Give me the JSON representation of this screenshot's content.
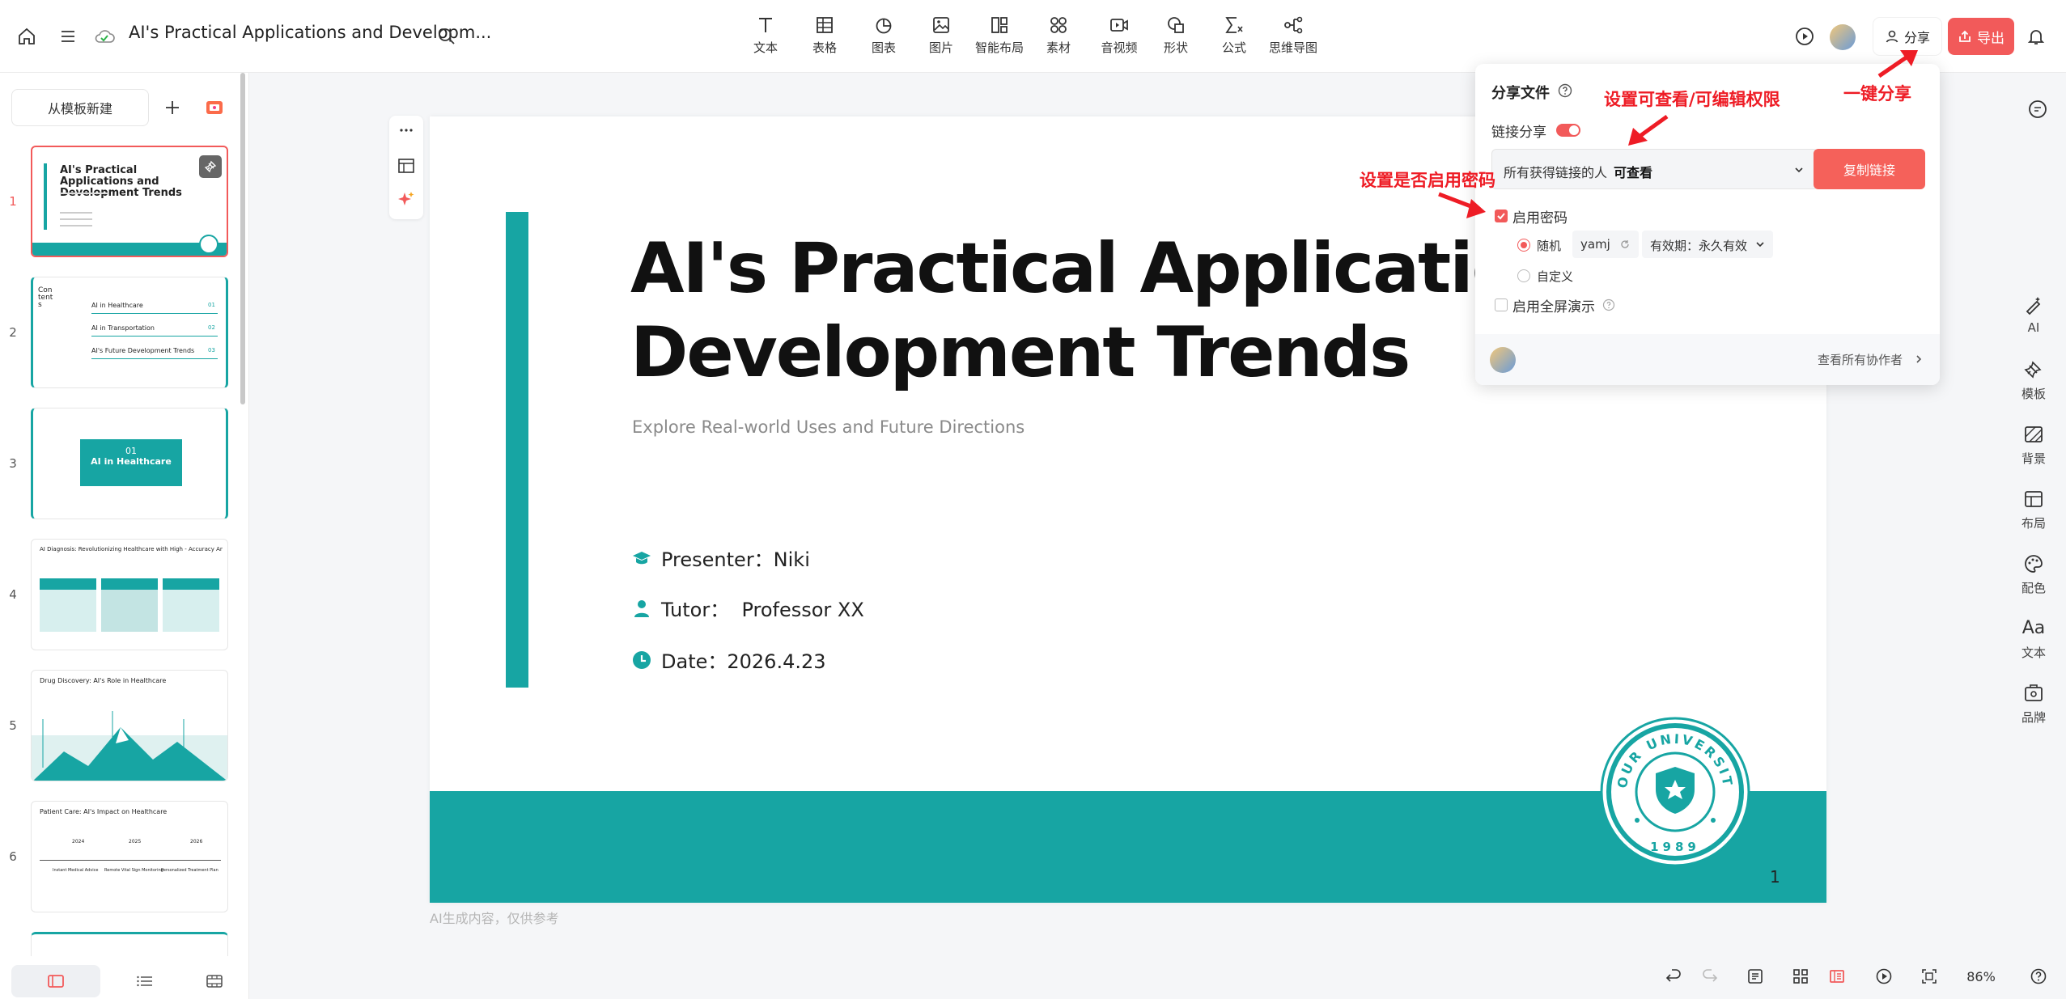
{
  "header": {
    "title": "AI's Practical Applications and Developm...",
    "tools": [
      {
        "icon": "text-icon",
        "label": "文本"
      },
      {
        "icon": "table-icon",
        "label": "表格"
      },
      {
        "icon": "chart-icon",
        "label": "图表"
      },
      {
        "icon": "image-icon",
        "label": "图片"
      },
      {
        "icon": "smart-layout-icon",
        "label": "智能布局"
      },
      {
        "icon": "assets-icon",
        "label": "素材"
      },
      {
        "icon": "media-icon",
        "label": "音视频"
      },
      {
        "icon": "shape-icon",
        "label": "形状"
      },
      {
        "icon": "formula-icon",
        "label": "公式"
      },
      {
        "icon": "mindmap-icon",
        "label": "思维导图"
      }
    ],
    "share_label": "分享",
    "export_label": "导出"
  },
  "left_panel": {
    "template_button": "从模板新建",
    "slide_numbers": [
      "1",
      "2",
      "3",
      "4",
      "5",
      "6"
    ],
    "thumb1": {
      "title": "AI's Practical Applications and Development Trends"
    },
    "thumb2": {
      "heading": "Contents",
      "items": [
        "AI in Healthcare",
        "AI in Transportation",
        "AI's Future Development Trends"
      ],
      "nums": [
        "01",
        "02",
        "03"
      ]
    },
    "thumb3": {
      "num": "01",
      "title": "AI in Healthcare"
    },
    "thumb4": {
      "title": "AI Diagnosis: Revolutionizing Healthcare with High - Accuracy Analysis"
    },
    "thumb5": {
      "title": "Drug Discovery: AI's Role in Healthcare"
    },
    "thumb6": {
      "title": "Patient Care: AI's Impact on Healthcare",
      "years": [
        "2024",
        "2025",
        "2026"
      ],
      "labels": [
        "Instant Medical Advice",
        "Remote Vital Sign Monitoring",
        "Personalized Treatment Plan"
      ]
    }
  },
  "slide": {
    "title_line1": "AI's Practical Applications",
    "title_line2": "Development Trends",
    "subtitle": "Explore Real-world Uses and Future Directions",
    "presenter": "Presenter：Niki",
    "tutor": "Tutor：  Professor XX",
    "date": "Date：2026.4.23",
    "seal_text": "YOUR UNIVERSITY",
    "seal_year": "1989",
    "page_number": "1",
    "accent_color": "#17a5a3"
  },
  "ai_note": "AI生成内容，仅供参考",
  "share_panel": {
    "title": "分享文件",
    "link_share_label": "链接分享",
    "link_share_on": true,
    "permission_prefix": "所有获得链接的人",
    "permission_value": "可查看",
    "copy_link": "复制链接",
    "enable_password": "启用密码",
    "password_checked": true,
    "random_label": "随机",
    "password_value": "yamj",
    "validity": "有效期：永久有效",
    "custom_label": "自定义",
    "fullscreen_label": "启用全屏演示",
    "view_collaborators": "查看所有协作者"
  },
  "annotations": {
    "one_click": "一键分享",
    "permission": "设置可查看/可编辑权限",
    "password": "设置是否启用密码",
    "color": "#ee1c25"
  },
  "right_toolbar": [
    {
      "icon": "ai-icon",
      "label": "AI"
    },
    {
      "icon": "template-icon",
      "label": "模板"
    },
    {
      "icon": "background-icon",
      "label": "背景"
    },
    {
      "icon": "layout-icon",
      "label": "布局"
    },
    {
      "icon": "palette-icon",
      "label": "配色"
    },
    {
      "icon": "text-style-icon",
      "label": "Aa"
    },
    {
      "icon": "text-style-label",
      "label": "文本"
    },
    {
      "icon": "brand-icon",
      "label": "品牌"
    }
  ],
  "bottom_bar": {
    "zoom": "86%"
  }
}
